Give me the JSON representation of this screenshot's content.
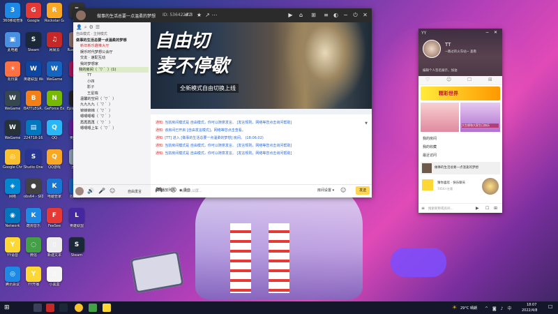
{
  "desktop": {
    "icons": [
      {
        "label": "360移动管家",
        "color": "#1e88e5",
        "glyph": "3"
      },
      {
        "label": "Google",
        "color": "#e53935",
        "glyph": "G"
      },
      {
        "label": "Rockstar Games",
        "color": "#f9a825",
        "glyph": "R"
      },
      {
        "label": "EPIC",
        "color": "#333333",
        "glyph": "E"
      },
      {
        "label": "此电脑",
        "color": "#4a90e2",
        "glyph": "▣"
      },
      {
        "label": "Steam",
        "color": "#1b2838",
        "glyph": "S"
      },
      {
        "label": "网易云",
        "color": "#c62828",
        "glyph": "♫"
      },
      {
        "label": "Rust Client",
        "color": "#8d6e63",
        "glyph": "R"
      },
      {
        "label": "向日葵",
        "color": "#ff7043",
        "glyph": "☀"
      },
      {
        "label": "英雄联盟 WeGame",
        "color": "#0d47a1",
        "glyph": "W"
      },
      {
        "label": "WeGame",
        "color": "#1565c0",
        "glyph": "W"
      },
      {
        "label": "完美",
        "color": "#ad1457",
        "glyph": "P"
      },
      {
        "label": "WeGame",
        "color": "#37474f",
        "glyph": "W"
      },
      {
        "label": "BATTLEGR...",
        "color": "#f57f17",
        "glyph": "B"
      },
      {
        "label": "GeForce Experience",
        "color": "#76b900",
        "glyph": "N"
      },
      {
        "label": "Epic Games",
        "color": "#222222",
        "glyph": "E"
      },
      {
        "label": "WeGame",
        "color": "#263238",
        "glyph": "W"
      },
      {
        "label": "224718-16...",
        "color": "#0277bd",
        "glyph": "▤"
      },
      {
        "label": "QQ",
        "color": "#29b6f6",
        "glyph": "Q"
      },
      {
        "label": "英雄联盟",
        "color": "#6a1b9a",
        "glyph": "L"
      },
      {
        "label": "Google Chrome",
        "color": "#fbc02d",
        "glyph": "◎"
      },
      {
        "label": "Studio One 5",
        "color": "#283593",
        "glyph": "S"
      },
      {
        "label": "QQ游戏",
        "color": "#f9a825",
        "glyph": "Q"
      },
      {
        "label": "回收站",
        "color": "#90a4ae",
        "glyph": "♻"
      },
      {
        "label": "网络",
        "color": "#0288d1",
        "glyph": "◈"
      },
      {
        "label": "obs64 - 快捷方式",
        "color": "#424242",
        "glyph": "●"
      },
      {
        "label": "电脑管家",
        "color": "#1976d2",
        "glyph": "K"
      },
      {
        "label": "控制面板",
        "color": "#1565c0",
        "glyph": "⚙"
      },
      {
        "label": "Network",
        "color": "#0277bd",
        "glyph": "◉"
      },
      {
        "label": "酷狗音乐",
        "color": "#1e88e5",
        "glyph": "K"
      },
      {
        "label": "FeeSee",
        "color": "#e53935",
        "glyph": "F"
      },
      {
        "label": "英雄联盟",
        "color": "#4527a0",
        "glyph": "L"
      },
      {
        "label": "YY语音",
        "color": "#fdd835",
        "glyph": "Y"
      },
      {
        "label": "微信",
        "color": "#43a047",
        "glyph": "◌"
      },
      {
        "label": "新建文本",
        "color": "#eeeeee",
        "glyph": "▯"
      },
      {
        "label": "Steam",
        "color": "#1b2838",
        "glyph": "S"
      },
      {
        "label": "腾讯会议",
        "color": "#1e88e5",
        "glyph": "◎"
      },
      {
        "label": "YY开播",
        "color": "#fdd835",
        "glyph": "Y"
      },
      {
        "label": "小黑盒",
        "color": "#f5f5f5",
        "glyph": "▯"
      }
    ]
  },
  "yy": {
    "title": "做事的生活总要一点温柔的梦想",
    "room_id": "53642282",
    "online": "3",
    "search_placeholder": "",
    "channel_mode": "自由模式 · 主持模式",
    "channels": [
      {
        "text": "做事的生活总要一点温柔的梦想",
        "style": "bold"
      },
      {
        "text": "新年新乐趣推大厅",
        "style": "red"
      },
      {
        "text": "娱乐时代梦想公会厅",
        "style": "normal"
      },
      {
        "text": "交友 · 速配互动",
        "style": "normal"
      },
      {
        "text": "我的梦想家",
        "style": "normal"
      },
      {
        "text": "我的房间（ ´▽｀ ）(1)",
        "style": "highlight"
      },
      {
        "text": "TT",
        "style": "user"
      },
      {
        "text": "小四",
        "style": "user"
      },
      {
        "text": "影子",
        "style": "user"
      },
      {
        "text": "王星瑞",
        "style": "user"
      },
      {
        "text": "温馨的空间（ ´▽｀ ）",
        "style": "normal"
      },
      {
        "text": "九九九九（ ´▽｀ ）",
        "style": "normal"
      },
      {
        "text": "锦锦锦锦（ ´▽｀ ）",
        "style": "normal"
      },
      {
        "text": "嗯嗯嗯嗯（ ´▽｀ ）",
        "style": "normal"
      },
      {
        "text": "再再再再（ ´▽｀ ）",
        "style": "normal"
      },
      {
        "text": "嗯嗯嗯上车（ ´▽｀ ）",
        "style": "normal"
      }
    ],
    "banner": {
      "line1": "自由切",
      "line2": "麦不停歇",
      "line3": "全新模式自由切换上线"
    },
    "messages": [
      {
        "tag": "通知:",
        "text": "当前房间模式是 自由模式，你可以随意发言。 [发言规则，网络等您点击询问帮助]"
      },
      {
        "tag": "通知:",
        "text": "该房间已开启 [自由发言模式]，网络等您点击查看。"
      },
      {
        "tag": "通知:",
        "text": "[TT] 进入 [做事的生活总要一点温柔的梦想] 房间。 (18:06:02)"
      },
      {
        "tag": "通知:",
        "text": "当前房间模式是 自由模式，你可以随意发言。 [发言规则，网络等您点击询问帮助]"
      },
      {
        "tag": "通知:",
        "text": "当前房间模式是 自由模式，你可以随意发言。 [发言规则，网络等您点击询问帮助]"
      }
    ],
    "input_placeholder": "请输入公屏...",
    "bottom": {
      "free_speak": "自由发言",
      "playlist": "播放列表",
      "record": "录音",
      "room_settings": "房间设置",
      "send": "发送"
    }
  },
  "side": {
    "title": "YY",
    "user_name": "TT",
    "user_sub": "~路过的火车站~ 查看",
    "signature": "编辑个人签名展示，加油",
    "banner_label": "精彩世界",
    "photo_caption": "大生缘和大家生日快乐",
    "menu": [
      "我的房间",
      "我的收藏",
      "最近访问"
    ],
    "recent_room": "做事的生活总要一点温柔的梦想",
    "ad_title": "猜你喜欢 · 快乐聊天",
    "ad_sub": "7454人在看",
    "search_placeholder": "搜索昵称或房间..."
  },
  "taskbar": {
    "weather": "29°C 晴朗",
    "time": "18:07",
    "date": "2022/4/8"
  }
}
